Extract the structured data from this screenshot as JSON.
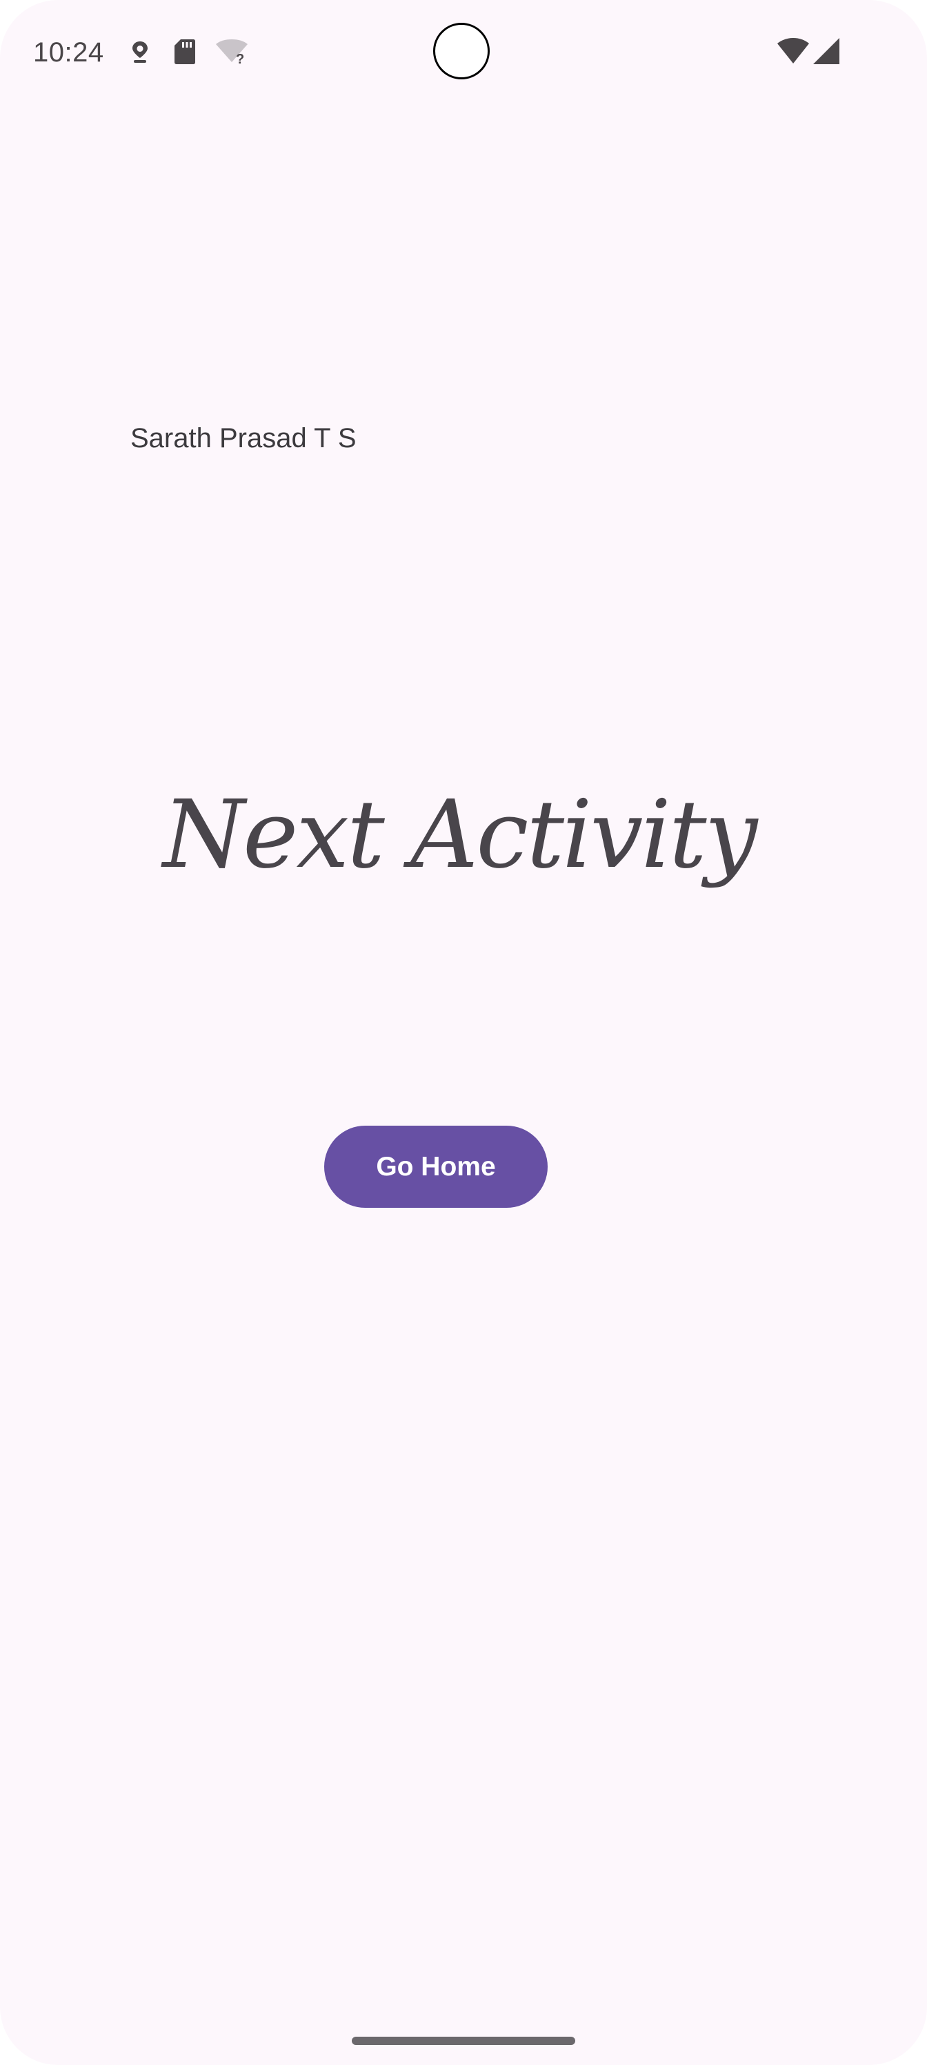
{
  "status_bar": {
    "time": "10:24",
    "icons": [
      "location-pin-icon",
      "sd-card-icon",
      "wifi-unknown-icon",
      "wifi-icon",
      "cell-signal-icon"
    ]
  },
  "content": {
    "author_name": "Sarath Prasad T S",
    "title": "Next Activity",
    "go_home_label": "Go Home"
  },
  "colors": {
    "background": "#fdf7fc",
    "primary": "#6750a4",
    "on_primary": "#ffffff",
    "text": "#49454b"
  }
}
